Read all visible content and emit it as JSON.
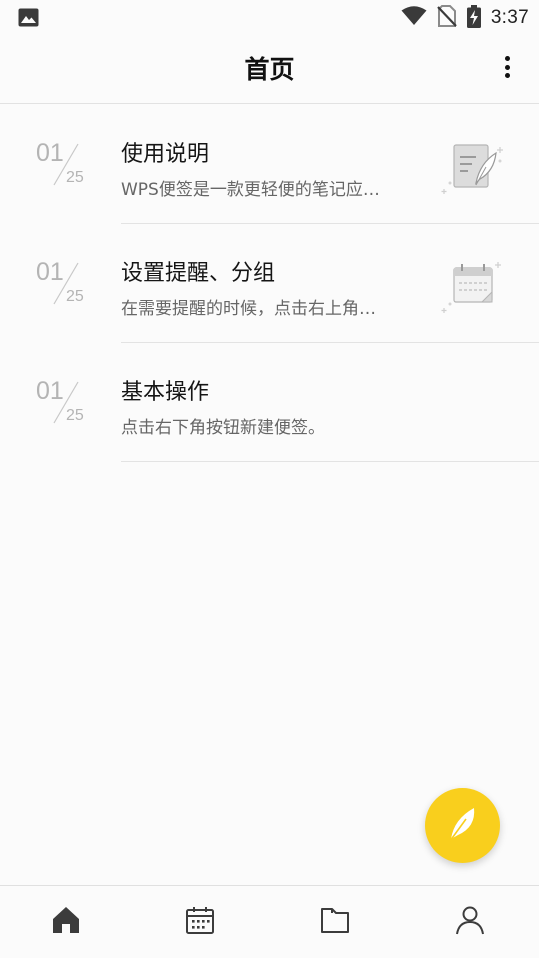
{
  "status_bar": {
    "time": "3:37",
    "icons": [
      "image-icon",
      "wifi-icon",
      "no-sim-icon",
      "battery-charging-icon"
    ]
  },
  "app_bar": {
    "title": "首页",
    "menu_icon": "more-vertical-icon"
  },
  "notes": [
    {
      "day": "01",
      "month": "25",
      "title": "使用说明",
      "snippet": "WPS便签是一款更轻便的笔记应…",
      "thumbnail_icon": "note-feather-icon"
    },
    {
      "day": "01",
      "month": "25",
      "title": "设置提醒、分组",
      "snippet": "在需要提醒的时候，点击右上角…",
      "thumbnail_icon": "calendar-note-icon"
    },
    {
      "day": "01",
      "month": "25",
      "title": "基本操作",
      "snippet": "点击右下角按钮新建便签。",
      "thumbnail_icon": ""
    }
  ],
  "fab": {
    "icon": "feather-icon",
    "color": "#f9cf1d"
  },
  "bottom_nav": {
    "items": [
      {
        "icon": "home-icon",
        "active": true
      },
      {
        "icon": "calendar-icon",
        "active": false
      },
      {
        "icon": "folder-icon",
        "active": false
      },
      {
        "icon": "user-icon",
        "active": false
      }
    ]
  },
  "colors": {
    "background": "#fbfbfb",
    "accent": "#f9cf1d",
    "text_primary": "#151515",
    "text_secondary": "#666666",
    "date_text": "#b4b4b4"
  }
}
